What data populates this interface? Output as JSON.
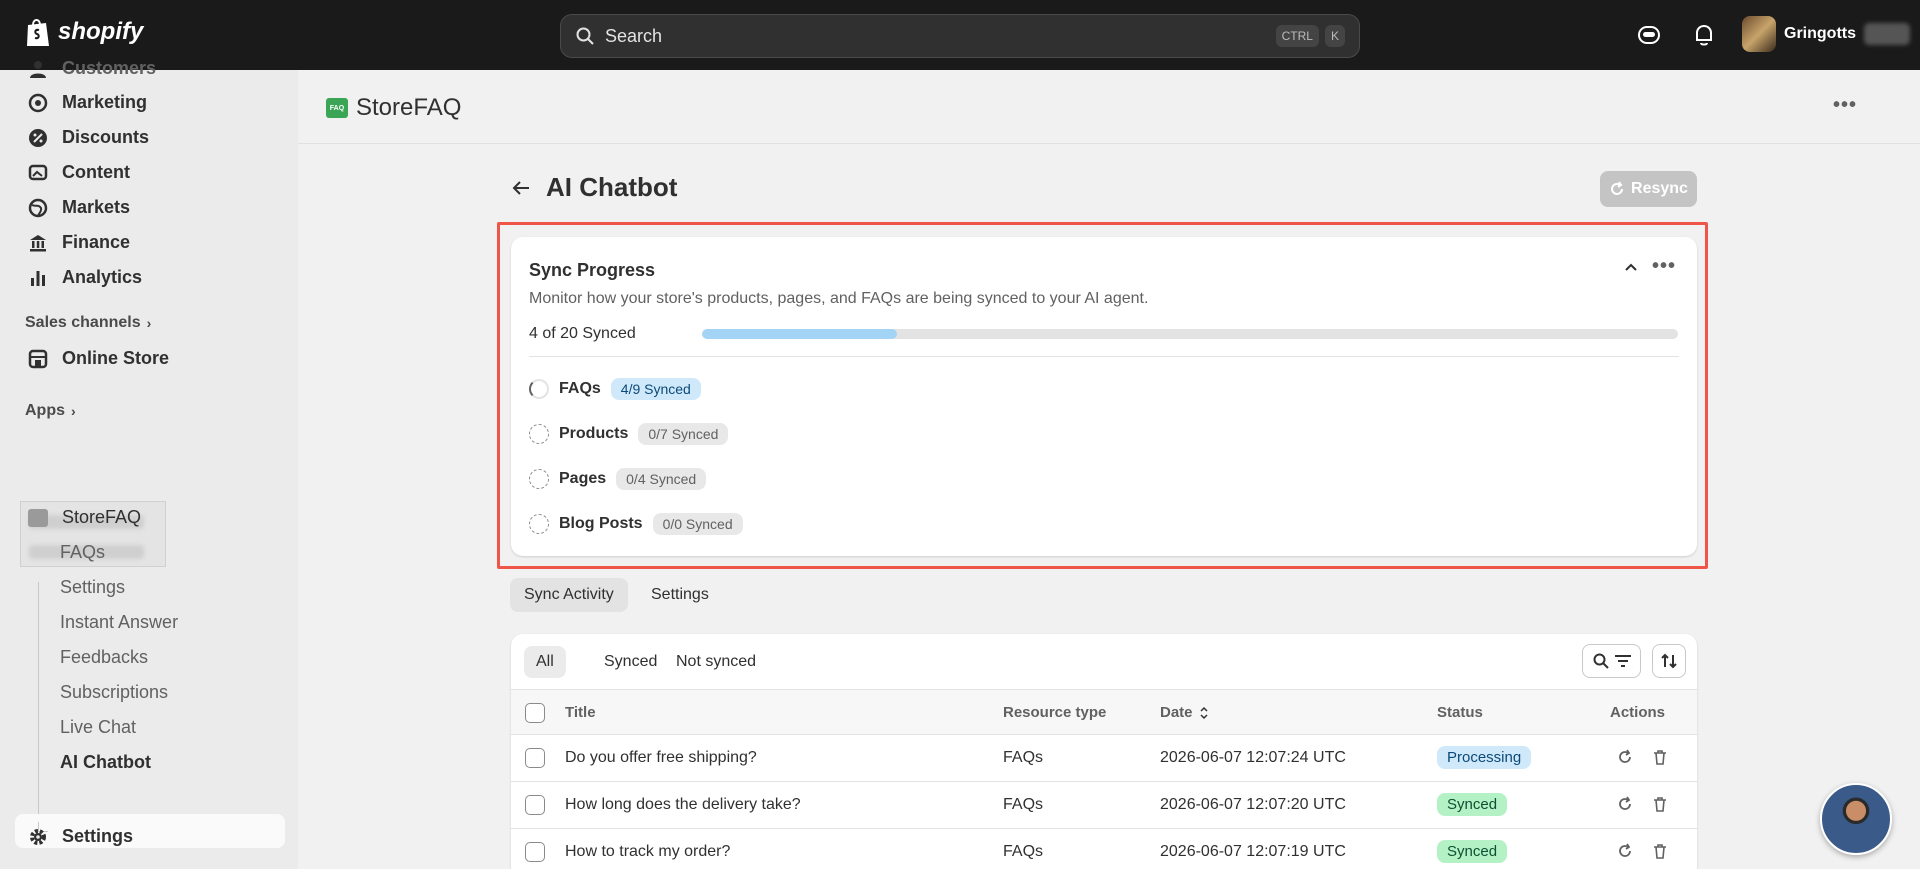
{
  "topbar": {
    "brand": "shopify",
    "search_placeholder": "Search",
    "shortcut_ctrl": "CTRL",
    "shortcut_key": "K",
    "store_name": "Gringotts"
  },
  "sidebar": {
    "partial_item": "Customers",
    "items": [
      {
        "label": "Marketing",
        "icon": "target-icon"
      },
      {
        "label": "Discounts",
        "icon": "discount-icon"
      },
      {
        "label": "Content",
        "icon": "image-icon"
      },
      {
        "label": "Markets",
        "icon": "globe-icon"
      },
      {
        "label": "Finance",
        "icon": "bank-icon"
      },
      {
        "label": "Analytics",
        "icon": "bar-chart-icon"
      }
    ],
    "sales_channels_label": "Sales channels",
    "online_store": "Online Store",
    "apps_label": "Apps",
    "app_name": "StoreFAQ",
    "app_sub_items": [
      "FAQs",
      "Settings",
      "Instant Answer",
      "Feedbacks",
      "Subscriptions",
      "Live Chat",
      "AI Chatbot"
    ],
    "settings": "Settings"
  },
  "app_header": {
    "title": "StoreFAQ",
    "icon_text": "FAQ"
  },
  "page": {
    "title": "AI Chatbot",
    "resync_label": "Resync"
  },
  "sync_progress": {
    "title": "Sync Progress",
    "subtitle": "Monitor how your store's products, pages, and FAQs are being synced to your AI agent.",
    "summary": "4 of 20 Synced",
    "progress_fraction": 0.2,
    "rows": [
      {
        "name": "FAQs",
        "badge": "4/9 Synced",
        "state": "partial"
      },
      {
        "name": "Products",
        "badge": "0/7 Synced",
        "state": "pending"
      },
      {
        "name": "Pages",
        "badge": "0/4 Synced",
        "state": "pending"
      },
      {
        "name": "Blog Posts",
        "badge": "0/0 Synced",
        "state": "pending"
      }
    ]
  },
  "tabs": [
    "Sync Activity",
    "Settings"
  ],
  "filters": [
    "All",
    "Synced",
    "Not synced"
  ],
  "table": {
    "headers": [
      "Title",
      "Resource type",
      "Date",
      "Status",
      "Actions"
    ],
    "rows": [
      {
        "title": "Do you offer free shipping?",
        "type": "FAQs",
        "date": "2026-06-07 12:07:24 UTC",
        "status": "Processing"
      },
      {
        "title": "How long does the delivery take?",
        "type": "FAQs",
        "date": "2026-06-07 12:07:20 UTC",
        "status": "Synced"
      },
      {
        "title": "How to track my order?",
        "type": "FAQs",
        "date": "2026-06-07 12:07:19 UTC",
        "status": "Synced"
      }
    ]
  },
  "colors": {
    "highlight": "#f0554a",
    "progress_fill": "#a4d4f5",
    "synced_badge": "#b4f2c6",
    "processing_badge": "#cfe9fb"
  }
}
